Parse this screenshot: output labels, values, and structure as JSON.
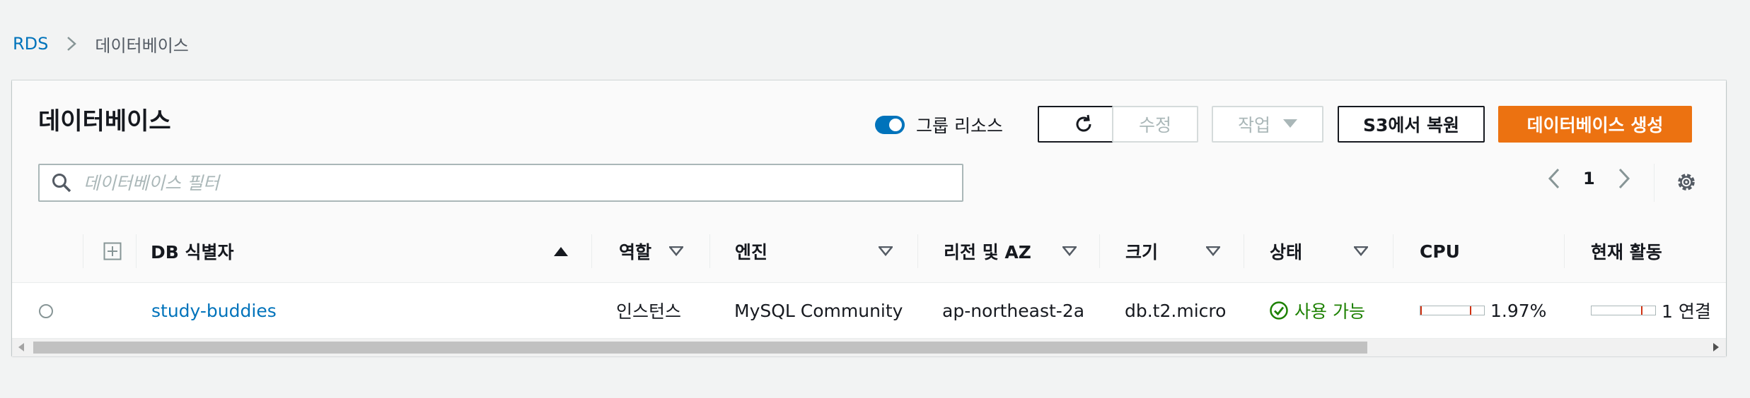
{
  "breadcrumb": {
    "root": "RDS",
    "current": "데이터베이스"
  },
  "panel": {
    "title": "데이터베이스",
    "group_toggle_label": "그룹 리소스",
    "group_toggle_on": true,
    "buttons": {
      "modify": "수정",
      "actions": "작업",
      "restore_s3": "S3에서 복원",
      "create": "데이터베이스 생성"
    },
    "search": {
      "placeholder": "데이터베이스 필터",
      "value": ""
    },
    "pagination": {
      "current_page": "1"
    }
  },
  "table": {
    "columns": {
      "identifier": "DB 식별자",
      "role": "역할",
      "engine": "엔진",
      "region_az": "리전 및 AZ",
      "size": "크기",
      "status": "상태",
      "cpu": "CPU",
      "activity": "현재 활동"
    },
    "rows": [
      {
        "identifier": "study-buddies",
        "role": "인스턴스",
        "engine": "MySQL Community",
        "region_az": "ap-northeast-2a",
        "size": "db.t2.micro",
        "status": "사용 가능",
        "cpu": "1.97%",
        "cpu_fraction": 0.0197,
        "activity": "1 연결"
      }
    ]
  },
  "colors": {
    "accent": "#0073bb",
    "primary_button": "#ec7211",
    "status_available": "#1d8102",
    "background": "#f2f3f3"
  },
  "icons": {
    "breadcrumb_separator": "chevron-right-icon",
    "refresh": "refresh-icon",
    "search": "search-icon",
    "settings": "gear-icon",
    "expand_all": "plus-square-icon",
    "status": "check-circle-icon"
  }
}
